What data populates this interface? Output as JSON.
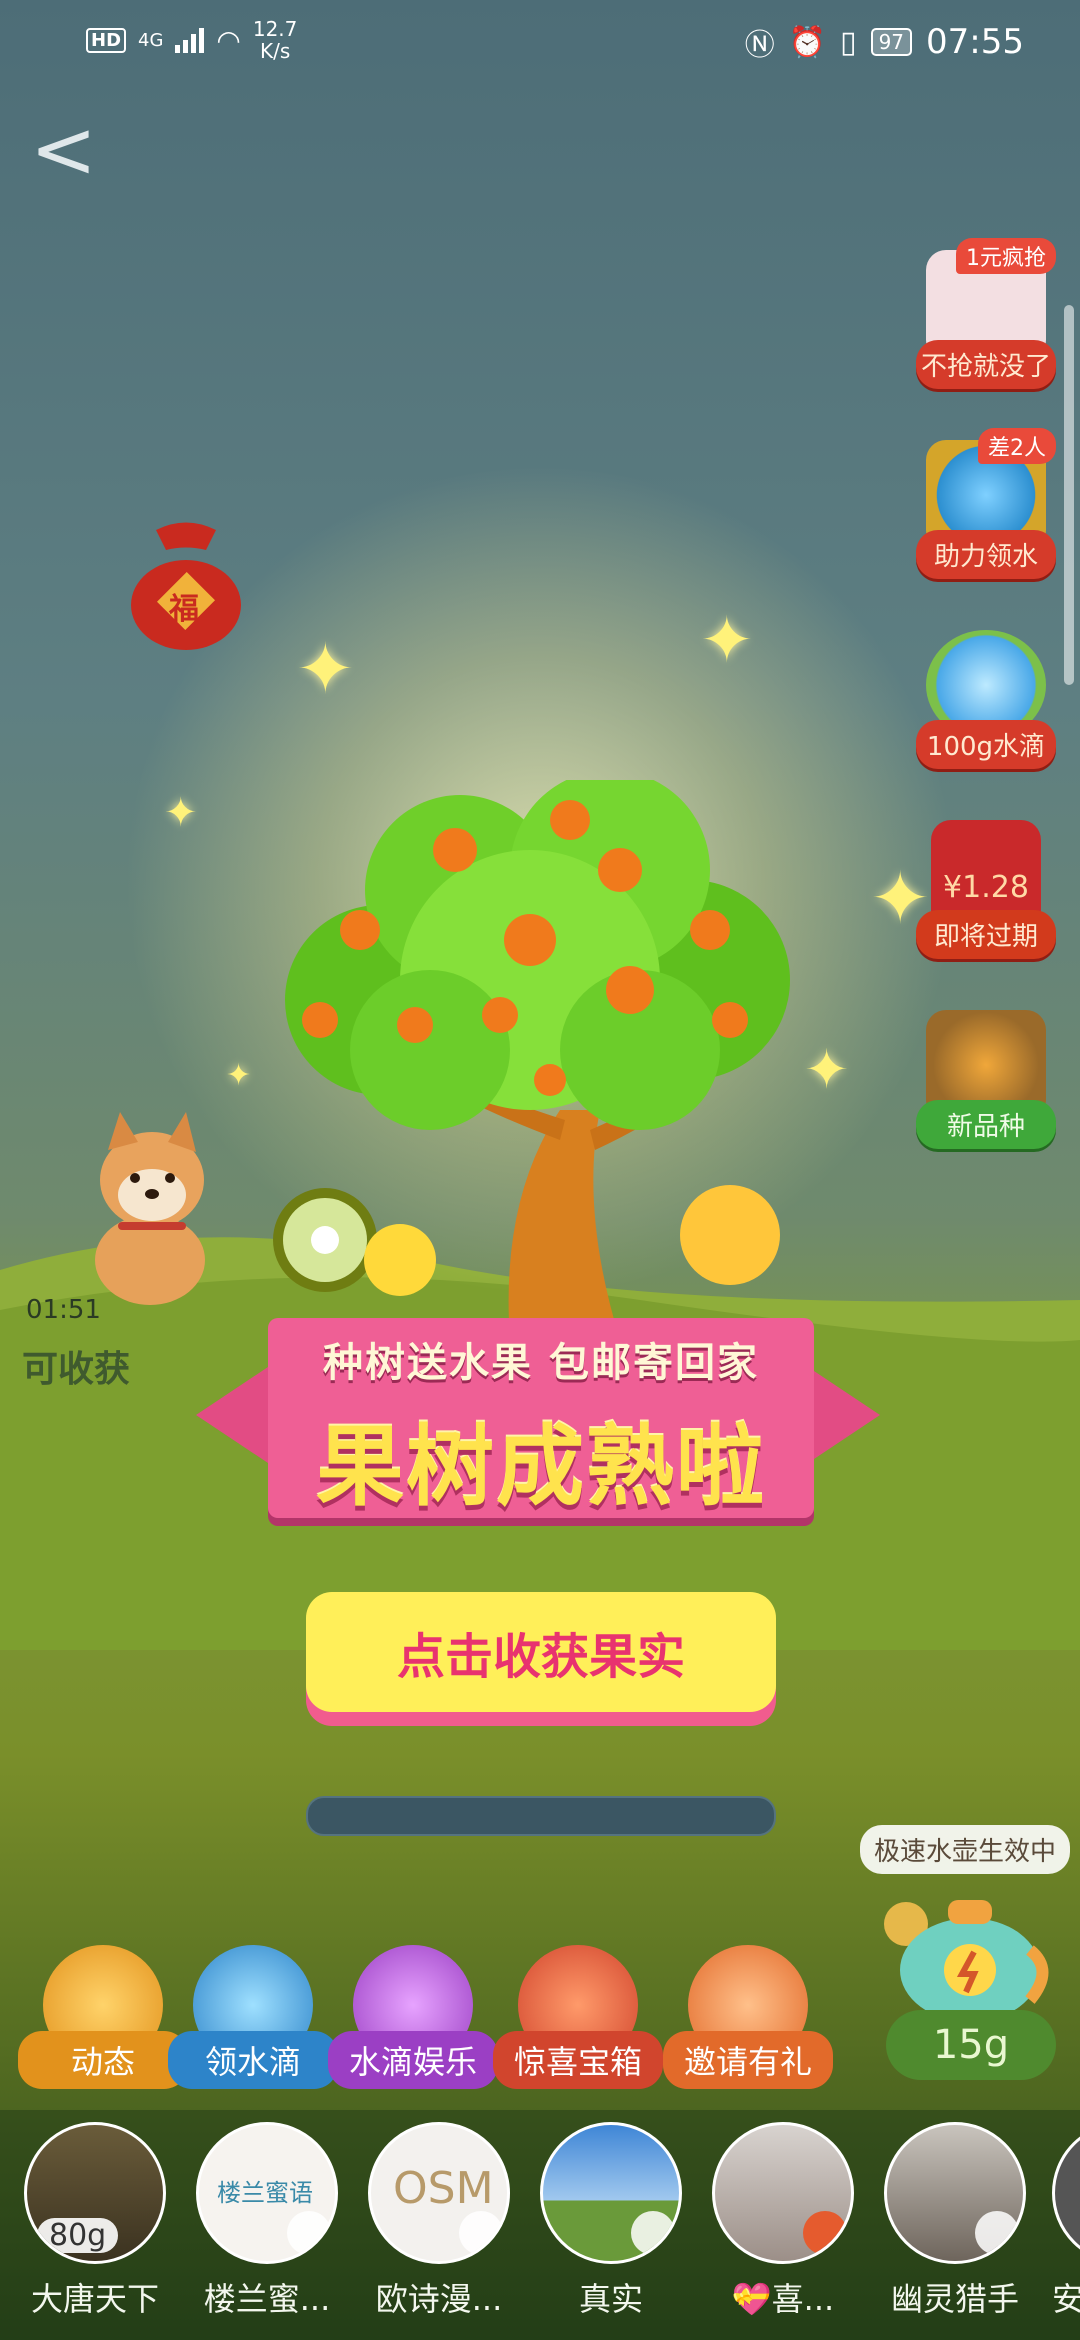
{
  "status_bar": {
    "hd": "HD",
    "network": "4G",
    "speed_value": "12.7",
    "speed_unit": "K/s",
    "battery": "97",
    "time": "07:55"
  },
  "back_label": "<",
  "promos": [
    {
      "tag": "1元疯抢",
      "label": "不抢就没了"
    },
    {
      "tag": "差2人",
      "label": "助力领水"
    },
    {
      "tag": "",
      "label": "100g水滴"
    },
    {
      "price": "¥1.28",
      "label": "即将过期"
    },
    {
      "tag": "",
      "label": "新品种"
    }
  ],
  "bag_text": "福",
  "pet": {
    "timer": "01:51",
    "status": "可收获"
  },
  "modal": {
    "subtitle": "种树送水果 包邮寄回家",
    "title": "果树成熟啦",
    "button": "点击收获果实"
  },
  "kettle": {
    "badge": "极速水壶生效中",
    "amount": "15g"
  },
  "actions": [
    {
      "label": "动态",
      "color": "#e2921c"
    },
    {
      "label": "领水滴",
      "color": "#2d84c9"
    },
    {
      "label": "水滴娱乐",
      "color": "#9b3fc4"
    },
    {
      "label": "惊喜宝箱",
      "color": "#d1452d"
    },
    {
      "label": "邀请有礼",
      "color": "#e26a2a"
    }
  ],
  "friends": [
    {
      "name": "大唐天下",
      "badge": "80g"
    },
    {
      "name": "楼兰蜜...",
      "badge": "",
      "logo": "楼兰蜜语"
    },
    {
      "name": "欧诗漫...",
      "badge": "",
      "logo": "OSM"
    },
    {
      "name": "真实",
      "badge": ""
    },
    {
      "name": "💝喜...",
      "badge": ""
    },
    {
      "name": "幽灵猎手",
      "badge": ""
    },
    {
      "name": "安",
      "badge": ""
    }
  ]
}
